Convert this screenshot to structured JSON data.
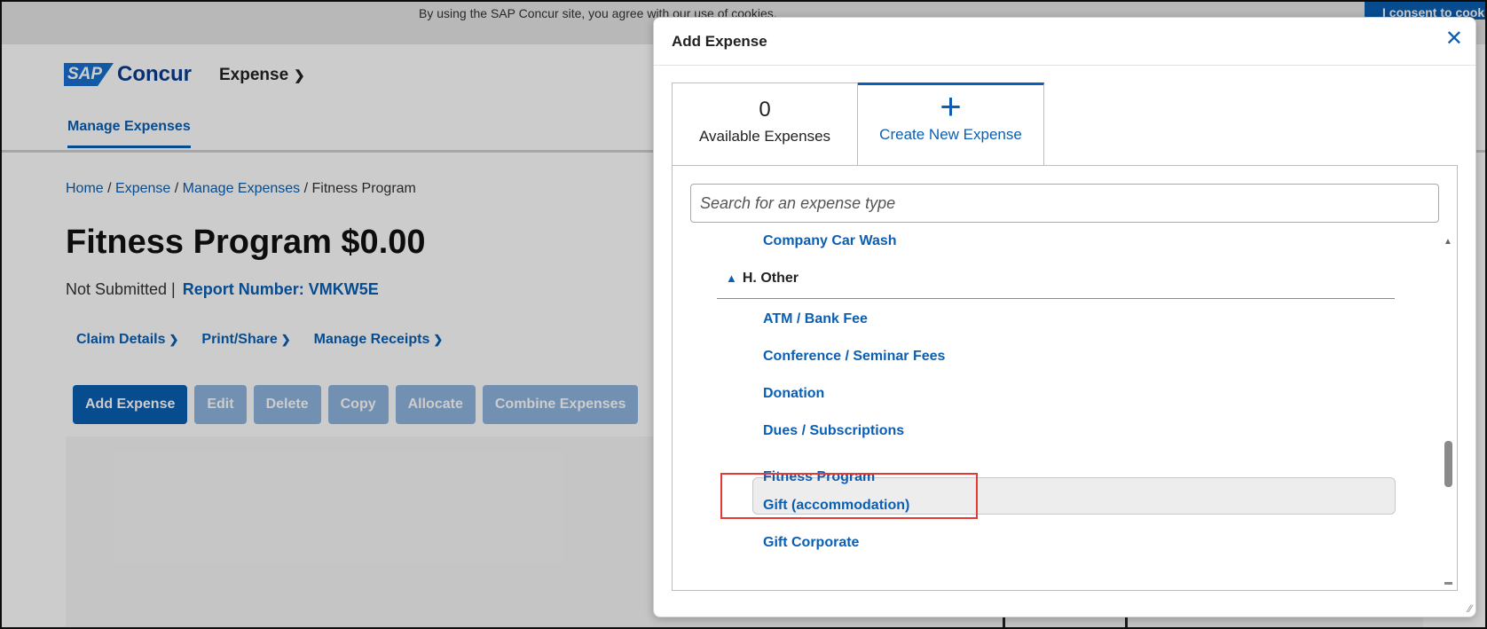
{
  "cookie": {
    "text": "By using the SAP Concur site, you agree with our use of cookies.",
    "consent": "I consent to cookies"
  },
  "header": {
    "logo_sap": "SAP",
    "logo_concur": "Concur",
    "product": "Expense",
    "nav_tab": "Manage Expenses"
  },
  "breadcrumb": {
    "home": "Home",
    "expense": "Expense",
    "manage": "Manage Expenses",
    "current": "Fitness Program",
    "sep": " / "
  },
  "report": {
    "title": "Fitness Program $0.00",
    "status": "Not Submitted |",
    "report_number": "Report Number: VMKW5E"
  },
  "sub_menus": [
    "Claim Details",
    "Print/Share",
    "Manage Receipts"
  ],
  "toolbar": [
    "Add Expense",
    "Edit",
    "Delete",
    "Copy",
    "Allocate",
    "Combine Expenses"
  ],
  "modal": {
    "title": "Add Expense",
    "tabs": [
      {
        "big": "0",
        "label": "Available Expenses"
      },
      {
        "big": "+",
        "label": "Create New Expense"
      }
    ],
    "search_placeholder": "Search for an expense type",
    "above_item": "Company Car Wash",
    "group": "H. Other",
    "items": [
      "ATM / Bank Fee",
      "Conference / Seminar Fees",
      "Donation",
      "Dues / Subscriptions",
      "Fitness Program",
      "Gift (accommodation)",
      "Gift Corporate"
    ]
  },
  "colors": {
    "accent": "#0a5fb4",
    "highlight_box": "#e53935"
  }
}
